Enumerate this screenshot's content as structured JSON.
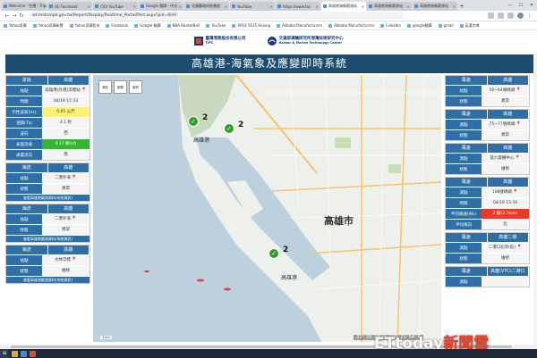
{
  "browser": {
    "tabs": [
      {
        "title": "Welcome - 空運 - Tripit",
        "active": false
      },
      {
        "title": "(6) Facebook",
        "active": false
      },
      {
        "title": "(50) YouTube",
        "active": false
      },
      {
        "title": "Google 翻譯 - 中文",
        "active": false
      },
      {
        "title": "花蓮縣政府秘書處",
        "active": false
      },
      {
        "title": "YouTube",
        "active": false
      },
      {
        "title": "https://www.fac",
        "active": false
      },
      {
        "title": "高雄港海象觀測站",
        "active": true
      },
      {
        "title": "高雄港海象觀測站",
        "active": false
      },
      {
        "title": "高雄港海象觀測站",
        "active": false
      }
    ],
    "new_tab_label": "+",
    "window_controls": {
      "minimize": "—",
      "maximize": "☐",
      "close": "✕"
    },
    "url": "wt.motcmpb.gov.tw/Report/Display/Realtime_Portal/Port.aspx?pid=KHH",
    "bookmarks": [
      "Yahoo奇摩",
      "Yahoo奇摩新聞",
      "Yahoo奇摩股市",
      "Facebook",
      "Google 翻譯",
      "NBA BasketBall",
      "YouTube",
      "0918 5615 Hsiang",
      "Alibaba Manufacturers",
      "Alibaba Manufacturers",
      "Linkedin",
      "google翻譯",
      "gmail",
      "英漢字典"
    ]
  },
  "header": {
    "logo_left": "臺灣港務股份有限公司",
    "logo_left_sub": "TIPC",
    "logo_right": "交通部運輸研究所港灣技術研究中心",
    "logo_right_sub": "Harbor & Marine Technology Center",
    "title": "高雄港-海氣象及應變即時系統"
  },
  "left_panel": {
    "cards": [
      {
        "head": [
          "波浪",
          "高雄"
        ],
        "rows": [
          {
            "k": "站點",
            "v": "高雄港(外港)浮標站",
            "style": "plain",
            "pin": true
          },
          {
            "k": "時間",
            "v": "04/19 11:33",
            "style": "plain",
            "pin": false
          },
          {
            "k": "示性波高(Hs)",
            "v": "0.65 公尺",
            "style": "yellow",
            "pin": false
          },
          {
            "k": "週期(Tz)",
            "v": "4.1 秒",
            "style": "plain",
            "pin": false
          },
          {
            "k": "波向",
            "v": "西",
            "style": "plain",
            "pin": false
          },
          {
            "k": "表面流速",
            "v": "0.17 節(kt)",
            "style": "green",
            "pin": false
          },
          {
            "k": "表層流向",
            "v": "南",
            "style": "plain",
            "pin": false
          }
        ]
      },
      {
        "head": [
          "海流",
          "高雄"
        ],
        "rows": [
          {
            "k": "站點",
            "v": "二港外海",
            "style": "plain",
            "pin": true
          },
          {
            "k": "狀態",
            "v": "異常",
            "style": "plain",
            "pin": false
          }
        ],
        "foot": "查看高雄港觀測資料(系統資訊)"
      },
      {
        "head": [
          "海流",
          "高雄"
        ],
        "rows": [
          {
            "k": "站點",
            "v": "二港外海",
            "style": "plain",
            "pin": true
          },
          {
            "k": "狀態",
            "v": "異常",
            "style": "plain",
            "pin": false
          }
        ],
        "foot": "查看高雄港觀測資料(系統資訊)"
      },
      {
        "head": [
          "海流",
          "高雄"
        ],
        "rows": [
          {
            "k": "站點",
            "v": "大林浮標",
            "style": "plain",
            "pin": true
          },
          {
            "k": "狀態",
            "v": "維修",
            "style": "plain",
            "pin": false
          }
        ],
        "foot": "查看高雄港觀測資料(系統資訊)"
      }
    ]
  },
  "right_panel": {
    "cards": [
      {
        "head": [
          "風速",
          "高雄"
        ],
        "rows": [
          {
            "k": "站點",
            "v": "56~64號碼頭",
            "style": "plain",
            "pin": true
          },
          {
            "k": "狀態",
            "v": "異常",
            "style": "plain",
            "pin": false
          }
        ]
      },
      {
        "head": [
          "風速",
          "高雄"
        ],
        "rows": [
          {
            "k": "測點",
            "v": "75~77號碼頭",
            "style": "plain",
            "pin": true
          },
          {
            "k": "狀態",
            "v": "異常",
            "style": "plain",
            "pin": false
          }
        ]
      },
      {
        "head": [
          "風速",
          "高雄"
        ],
        "rows": [
          {
            "k": "測點",
            "v": "第六貨櫃中心",
            "style": "plain",
            "pin": true
          },
          {
            "k": "狀態",
            "v": "維修",
            "style": "plain",
            "pin": false
          }
        ]
      },
      {
        "head": [
          "風速",
          "高雄"
        ],
        "rows": [
          {
            "k": "測點",
            "v": "108號碼頭",
            "style": "plain",
            "pin": true
          },
          {
            "k": "時間",
            "v": "04/19 15:30",
            "style": "plain",
            "pin": false
          },
          {
            "k": "平均風速(Ws)",
            "v": "2 級(2.7m/s)",
            "style": "red",
            "pin": false
          },
          {
            "k": "平均風向",
            "v": "北",
            "style": "plain",
            "pin": false
          }
        ]
      },
      {
        "head": [
          "風速",
          "高雄二港"
        ],
        "rows": [
          {
            "k": "測點",
            "v": "二港口北岸(危)",
            "style": "plain",
            "pin": true
          },
          {
            "k": "狀態",
            "v": "維修",
            "style": "plain",
            "pin": false
          }
        ]
      },
      {
        "head": [
          "風速",
          "高雄(VTC)二港口"
        ],
        "rows": [
          {
            "k": "測點",
            "v": "",
            "style": "plain",
            "pin": false
          }
        ]
      }
    ]
  },
  "map": {
    "controls": [
      "港區",
      "圖層",
      "圖例"
    ],
    "labels": {
      "city": "高雄市",
      "port1": "高雄港",
      "port2": "高雄港"
    },
    "markers": [
      {
        "count": "2"
      },
      {
        "count": "2"
      },
      {
        "count": "2"
      }
    ],
    "coords": "22° 35' 38\" N 120° 21' 54\" E",
    "scale": "1 km"
  },
  "watermark": {
    "brand": "ETtoday",
    "suffix": "新聞雲"
  },
  "colors": {
    "header_bg": "#1c4c70",
    "card_head": "#2f6fa6",
    "yellow": "#fff07a",
    "green": "#35b534",
    "red": "#e73a2a",
    "marker": "#2f9e2f"
  }
}
